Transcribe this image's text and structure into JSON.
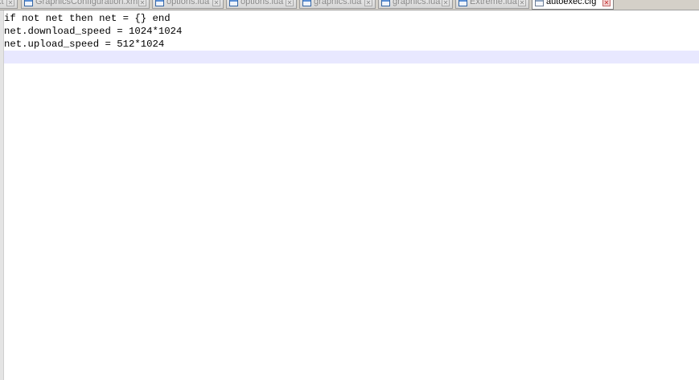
{
  "tabs": [
    {
      "label": "xt",
      "active": false
    },
    {
      "label": "GraphicsConfiguration.xml",
      "active": false
    },
    {
      "label": "options.lua",
      "active": false
    },
    {
      "label": "options.lua",
      "active": false
    },
    {
      "label": "graphics.lua",
      "active": false
    },
    {
      "label": "graphics.lua",
      "active": false
    },
    {
      "label": "Extreme.lua",
      "active": false
    },
    {
      "label": "autoexec.cfg",
      "active": true
    }
  ],
  "tab_close_glyph": "✕",
  "editor": {
    "lines": [
      "if not net then net = {} end",
      "net.download_speed = 1024*1024",
      "net.upload_speed = 512*1024",
      ""
    ],
    "current_line_color": "#e8e8ff"
  },
  "colors": {
    "tabbar_bg": "#d4d0c8",
    "inactive_tab_text": "#8a8a8a",
    "active_tab_text": "#000000",
    "editor_bg": "#ffffff"
  }
}
